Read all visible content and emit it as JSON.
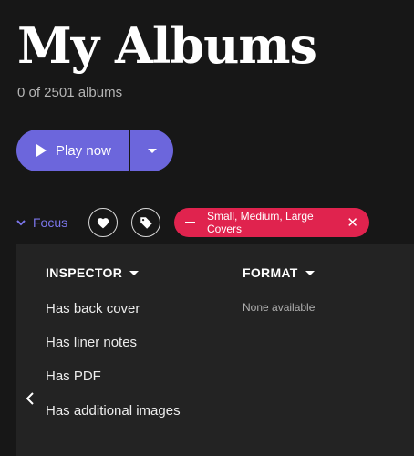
{
  "header": {
    "title": "My Albums",
    "subtitle": "0 of 2501 albums"
  },
  "actions": {
    "play_label": "Play now",
    "play_icon": "play-icon",
    "menu_icon": "chevron-down-icon"
  },
  "focus": {
    "label": "Focus",
    "favorite_icon": "heart-icon",
    "tag_icon": "tag-icon",
    "active_filter": "Small, Medium, Large Covers",
    "remove_icon": "close-icon"
  },
  "inspector": {
    "heading": "INSPECTOR",
    "items": [
      "Has back cover",
      "Has liner notes",
      "Has PDF",
      "Has additional images"
    ]
  },
  "format": {
    "heading": "FORMAT",
    "empty_text": "None available"
  },
  "colors": {
    "background": "#171717",
    "panel": "#232323",
    "accent": "#6c66dc",
    "filter_chip": "#e0234e"
  }
}
